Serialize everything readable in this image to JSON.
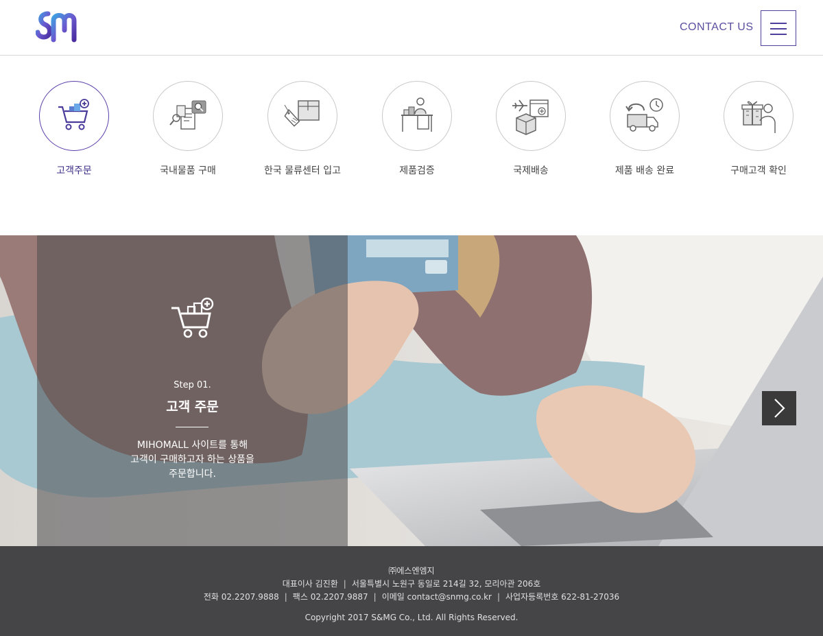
{
  "header": {
    "contact_label": "CONTACT US",
    "accent_color": "#4f3f9c"
  },
  "steps": [
    {
      "label": "고객주문",
      "icon": "cart-plus-icon",
      "active": true
    },
    {
      "label": "국내물품 구매",
      "icon": "search-receipt-icon",
      "active": false
    },
    {
      "label": "한국 물류센터 입고",
      "icon": "package-tag-icon",
      "active": false
    },
    {
      "label": "제품검증",
      "icon": "inspector-desk-icon",
      "active": false
    },
    {
      "label": "국제배송",
      "icon": "plane-box-icon",
      "active": false
    },
    {
      "label": "제품 배송 완료",
      "icon": "truck-clock-icon",
      "active": false
    },
    {
      "label": "구매고객 확인",
      "icon": "gift-person-icon",
      "active": false
    }
  ],
  "hero": {
    "step_number": "Step 01.",
    "title": "고객 주문",
    "desc_line1": "MIHOMALL 사이트를 통해",
    "desc_line2": "고객이 구매하고자 하는 상품을",
    "desc_line3": "주문합니다."
  },
  "footer": {
    "company": "㈜에스엔엠지",
    "ceo": "대표이사 김진환",
    "address": "서울특별시 노원구 동일로 214길 32, 모리아관 206호",
    "phone": "전화 02.2207.9888",
    "fax": "팩스 02.2207.9887",
    "email": "이메일 contact@snmg.co.kr",
    "biz_no": "사업자등록번호 622-81-27036",
    "copyright": "Copyright 2017 S&MG Co., Ltd. All Rights Reserved."
  }
}
